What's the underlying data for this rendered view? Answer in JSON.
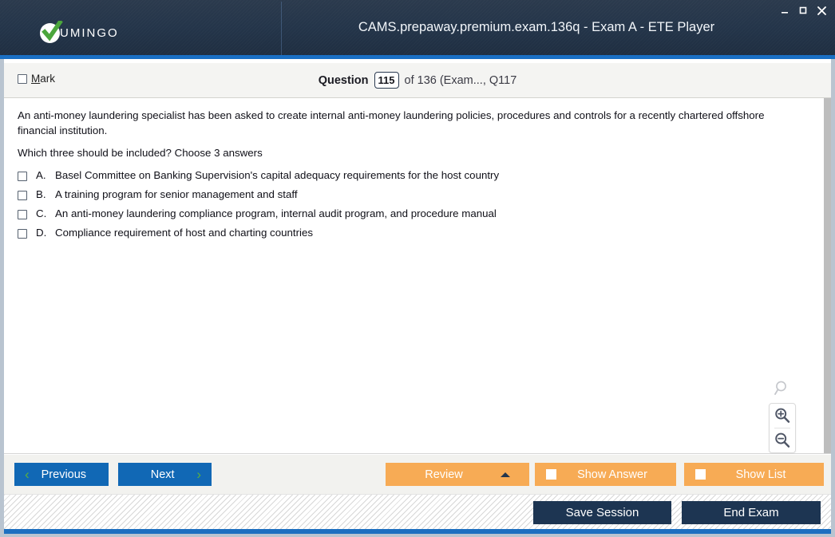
{
  "window": {
    "title": "CAMS.prepaway.premium.exam.136q - Exam A - ETE Player",
    "logo_text": "UMINGO",
    "controls": {
      "minimize": "minimize-icon",
      "maximize": "maximize-icon",
      "close": "close-icon"
    },
    "accent_color": "#1a6fc4",
    "titlebar_color": "#24354a"
  },
  "qheader": {
    "mark_label": "Mark",
    "mark_accel": "M",
    "mark_checked": false,
    "question_word": "Question",
    "question_number": "115",
    "of_text": "of 136 (Exam..., Q117"
  },
  "question": {
    "body": "An anti-money laundering specialist has been asked to create internal anti-money laundering policies, procedures and controls for a recently chartered offshore financial institution.",
    "prompt": "Which three should be included? Choose 3 answers",
    "options": [
      {
        "letter": "A.",
        "text": "Basel Committee on Banking Supervision's capital adequacy requirements for the host country",
        "checked": false
      },
      {
        "letter": "B.",
        "text": "A training program for senior management and staff",
        "checked": false
      },
      {
        "letter": "C.",
        "text": "An anti-money laundering compliance program, internal audit program, and procedure manual",
        "checked": false
      },
      {
        "letter": "D.",
        "text": "Compliance requirement of host and charting countries",
        "checked": false
      }
    ]
  },
  "zoom_controls": {
    "reset": "magnifier-icon",
    "zoom_in": "zoom-in-icon",
    "zoom_out": "zoom-out-icon"
  },
  "toolbar": {
    "previous_label": "Previous",
    "next_label": "Next",
    "review_label": "Review",
    "show_answer_label": "Show Answer",
    "show_list_label": "Show List",
    "show_answer_checked": false,
    "show_list_checked": false,
    "nav_button_color": "#1168b5",
    "orange_button_color": "#f7ab55",
    "chevron_color": "#5cb03c"
  },
  "footer": {
    "save_session_label": "Save Session",
    "end_exam_label": "End Exam",
    "dark_button_color": "#1d3552"
  }
}
